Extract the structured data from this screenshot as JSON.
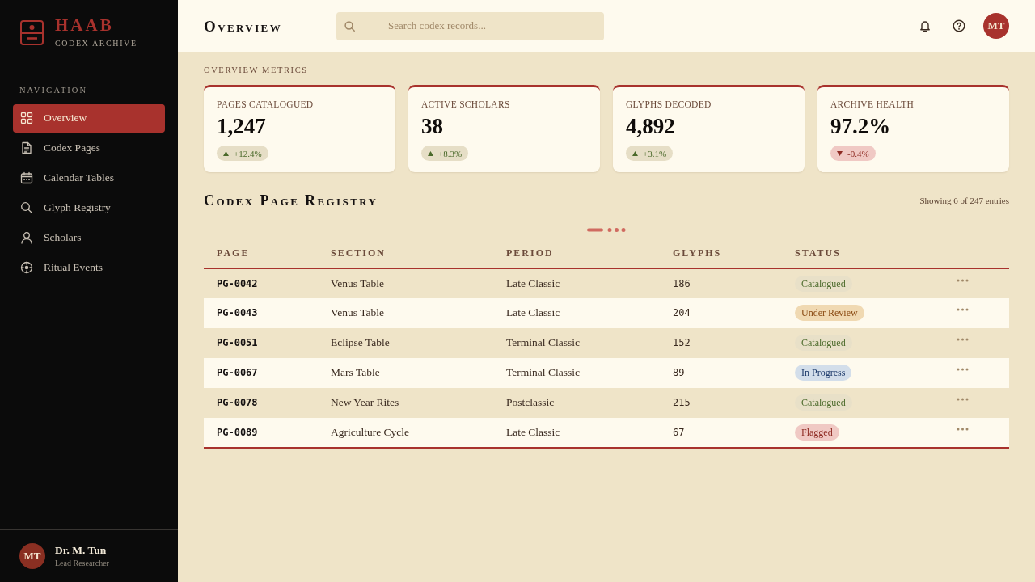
{
  "sidebar": {
    "brand": {
      "name": "HAAB",
      "subtitle": "CODEX ARCHIVE"
    },
    "section_label": "NAVIGATION",
    "items": [
      {
        "label": "Overview",
        "selected": true
      },
      {
        "label": "Codex Pages",
        "selected": false
      },
      {
        "label": "Calendar Tables",
        "selected": false
      },
      {
        "label": "Glyph Registry",
        "selected": false
      },
      {
        "label": "Scholars",
        "selected": false
      },
      {
        "label": "Ritual Events",
        "selected": false
      }
    ],
    "user": {
      "initials": "MT",
      "name": "Dr. M. Tun",
      "role": "Lead Researcher"
    }
  },
  "header": {
    "title": "Overview",
    "search": {
      "placeholder": "Search codex records..."
    },
    "avatar": {
      "initials": "MT"
    }
  },
  "metrics": {
    "title": "OVERVIEW METRICS",
    "cards": [
      {
        "label": "PAGES CATALOGUED",
        "value": "1,247",
        "change": "+12.4%",
        "kind": "rise"
      },
      {
        "label": "ACTIVE SCHOLARS",
        "value": "38",
        "change": "+8.3%",
        "kind": "rise"
      },
      {
        "label": "GLYPHS DECODED",
        "value": "4,892",
        "change": "+3.1%",
        "kind": "rise"
      },
      {
        "label": "ARCHIVE HEALTH",
        "value": "97.2%",
        "change": "-0.4%",
        "kind": "fall"
      }
    ]
  },
  "registry": {
    "title": "Codex Page Registry",
    "summary": "Showing 6 of 247 entries",
    "table": {
      "columns": [
        "PAGE",
        "SECTION",
        "PERIOD",
        "GLYPHS",
        "STATUS"
      ],
      "rows": [
        {
          "page": "PG-0042",
          "section": "Venus Table",
          "period": "Late Classic",
          "glyphs": "186",
          "status": {
            "label": "Catalogued",
            "kind": "catalogued"
          }
        },
        {
          "page": "PG-0043",
          "section": "Venus Table",
          "period": "Late Classic",
          "glyphs": "204",
          "status": {
            "label": "Under Review",
            "kind": "review"
          }
        },
        {
          "page": "PG-0051",
          "section": "Eclipse Table",
          "period": "Terminal Classic",
          "glyphs": "152",
          "status": {
            "label": "Catalogued",
            "kind": "catalogued"
          }
        },
        {
          "page": "PG-0067",
          "section": "Mars Table",
          "period": "Terminal Classic",
          "glyphs": "89",
          "status": {
            "label": "In Progress",
            "kind": "progress"
          }
        },
        {
          "page": "PG-0078",
          "section": "New Year Rites",
          "period": "Postclassic",
          "glyphs": "215",
          "status": {
            "label": "Catalogued",
            "kind": "catalogued"
          }
        },
        {
          "page": "PG-0089",
          "section": "Agriculture Cycle",
          "period": "Late Classic",
          "glyphs": "67",
          "status": {
            "label": "Flagged",
            "kind": "flagged"
          }
        }
      ]
    }
  }
}
